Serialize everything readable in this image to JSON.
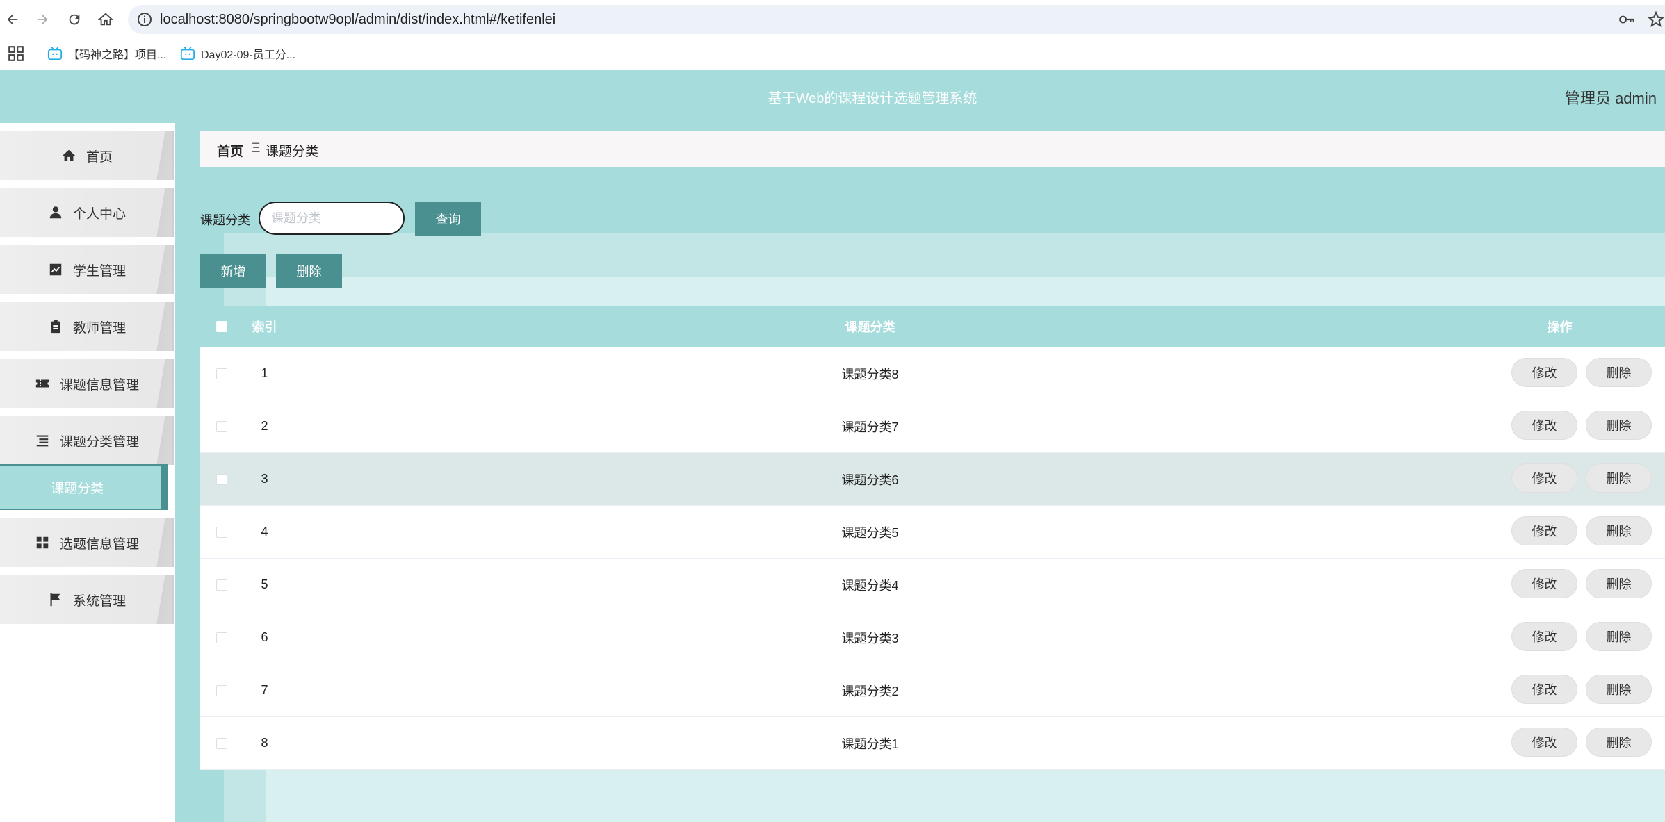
{
  "browser": {
    "url": "localhost:8080/springbootw9opl/admin/dist/index.html#/ketifenlei",
    "bookmarks": [
      {
        "label": "【码神之路】项目..."
      },
      {
        "label": "Day02-09-员工分..."
      }
    ]
  },
  "header": {
    "title": "基于Web的课程设计选题管理系统",
    "user": "管理员 admin"
  },
  "sidebar": {
    "items": [
      {
        "label": "首页",
        "icon": "home-icon"
      },
      {
        "label": "个人中心",
        "icon": "user-icon"
      },
      {
        "label": "学生管理",
        "icon": "chart-icon"
      },
      {
        "label": "教师管理",
        "icon": "clipboard-icon"
      },
      {
        "label": "课题信息管理",
        "icon": "ticket-icon"
      },
      {
        "label": "课题分类管理",
        "icon": "list-icon"
      },
      {
        "label": "选题信息管理",
        "icon": "grid-icon"
      },
      {
        "label": "系统管理",
        "icon": "flag-icon"
      }
    ],
    "active_sub": "课题分类"
  },
  "breadcrumb": {
    "home": "首页",
    "separator": "Ξ",
    "current": "课题分类"
  },
  "search": {
    "label": "课题分类",
    "placeholder": "课题分类",
    "value": "",
    "query_button": "查询"
  },
  "toolbar": {
    "add_button": "新增",
    "delete_button": "删除"
  },
  "table": {
    "headers": {
      "index": "索引",
      "category": "课题分类",
      "action": "操作"
    },
    "rows": [
      {
        "index": "1",
        "category": "课题分类8"
      },
      {
        "index": "2",
        "category": "课题分类7"
      },
      {
        "index": "3",
        "category": "课题分类6"
      },
      {
        "index": "4",
        "category": "课题分类5"
      },
      {
        "index": "5",
        "category": "课题分类4"
      },
      {
        "index": "6",
        "category": "课题分类3"
      },
      {
        "index": "7",
        "category": "课题分类2"
      },
      {
        "index": "8",
        "category": "课题分类1"
      }
    ],
    "edit_label": "修改",
    "delete_label": "删除",
    "highlighted_row": 3
  },
  "colors": {
    "primary": "#a6dcdc",
    "dark": "#4a9090",
    "row_highlight": "#dce7e7"
  }
}
